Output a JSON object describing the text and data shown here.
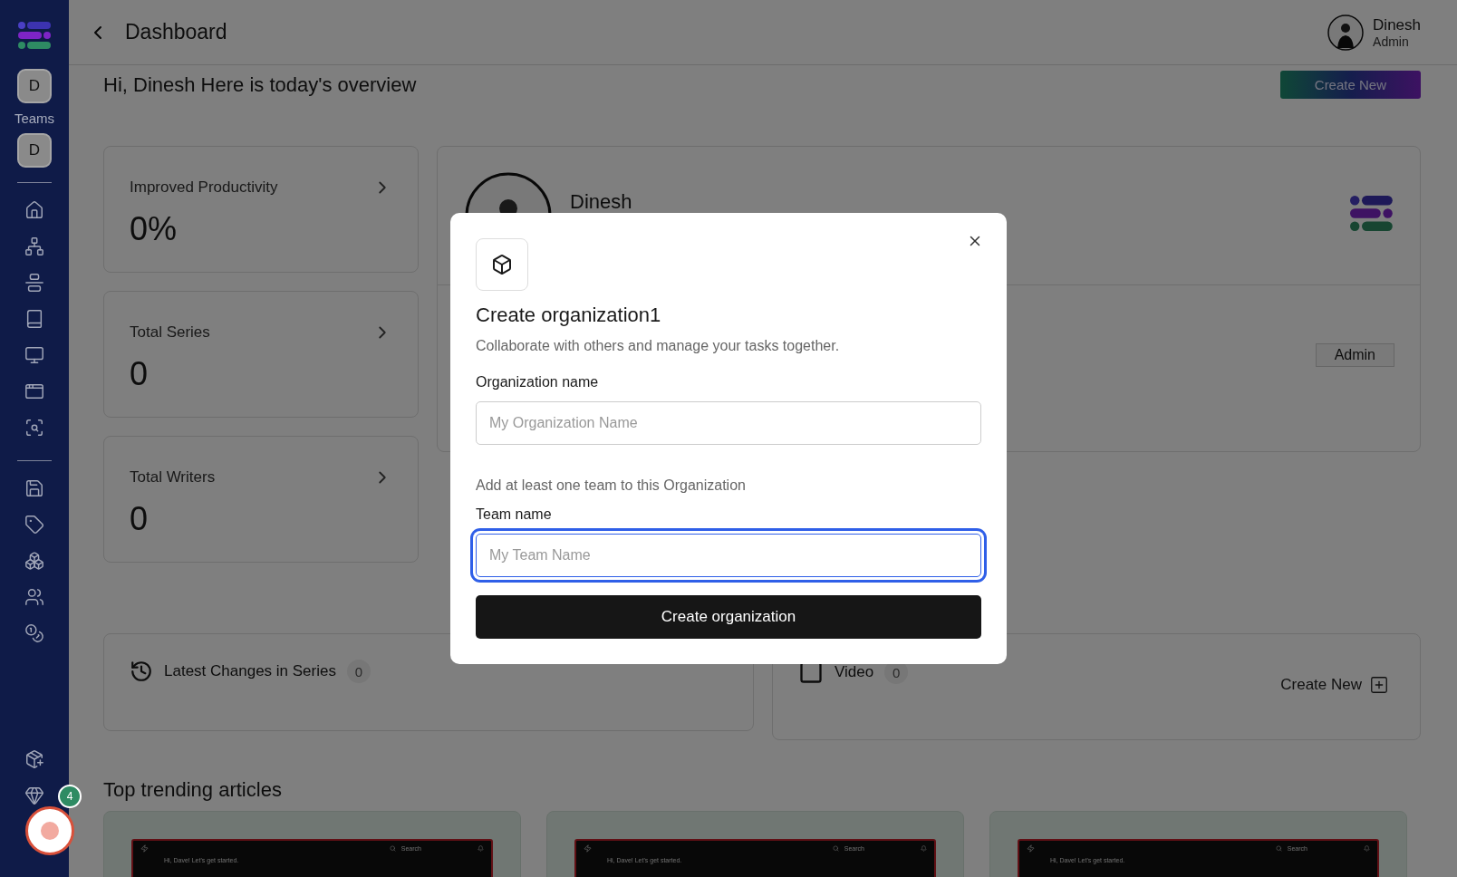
{
  "sidebar": {
    "teams_label": "Teams",
    "team_buttons": [
      "D",
      "D"
    ],
    "chat_badge": "4"
  },
  "header": {
    "title": "Dashboard",
    "user": {
      "name": "Dinesh",
      "role": "Admin"
    }
  },
  "greeting": "Hi, Dinesh Here is today's overview",
  "create_button": "Create New",
  "stats": [
    {
      "label": "Improved Productivity",
      "value": "0%"
    },
    {
      "label": "Total Series",
      "value": "0"
    },
    {
      "label": "Total Writers",
      "value": "0"
    }
  ],
  "profile_card": {
    "name": "Dinesh",
    "role_tag": "Admin"
  },
  "panels": [
    {
      "kind": "history",
      "title": "Latest Changes in Series",
      "count": "0"
    },
    {
      "kind": "video",
      "title": "Video",
      "count": "0",
      "action": "Create New"
    }
  ],
  "trending": {
    "title": "Top trending articles",
    "articles": [
      {
        "search": "Search",
        "greeting": "Hi, Dave! Let's get started."
      },
      {
        "search": "Search",
        "greeting": "Hi, Dave! Let's get started."
      },
      {
        "search": "Search",
        "greeting": "Hi, Dave! Let's get started."
      }
    ]
  },
  "modal": {
    "title": "Create organization1",
    "subtitle": "Collaborate with others and manage your tasks together.",
    "hint": "Add at least one team to this Organization",
    "submit": "Create organization",
    "fields": [
      {
        "label": "Organization name",
        "placeholder": "My Organization Name",
        "focused": false
      },
      {
        "label": "Team name",
        "placeholder": "My Team Name",
        "focused": true
      }
    ]
  }
}
